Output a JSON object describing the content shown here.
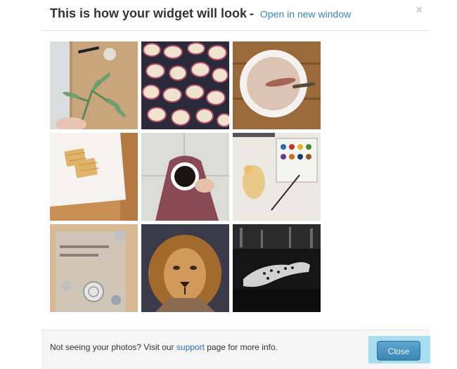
{
  "header": {
    "title": "This is how your widget will look",
    "separator": "-",
    "open_link": "Open in new window",
    "close_symbol": "×"
  },
  "photos": [
    {
      "subject": "plant sprig on wooden table",
      "icon": "plant-photo"
    },
    {
      "subject": "sliced red potatoes on tray",
      "icon": "potatoes-photo"
    },
    {
      "subject": "mug of hot chocolate",
      "icon": "cocoa-photo"
    },
    {
      "subject": "waffles on white plate",
      "icon": "waffles-photo"
    },
    {
      "subject": "coffee cup held on lap",
      "icon": "coffee-photo"
    },
    {
      "subject": "watercolor paints and sketch",
      "icon": "watercolor-photo"
    },
    {
      "subject": "crochet book and doilies",
      "icon": "crochet-photo"
    },
    {
      "subject": "lion head sculpture",
      "icon": "lion-photo"
    },
    {
      "subject": "leopard in black and white",
      "icon": "leopard-photo"
    }
  ],
  "footer": {
    "text_before": "Not seeing your photos? Visit our ",
    "support_link": "support",
    "text_after": " page for more info.",
    "close_button": "Close"
  },
  "colors": {
    "link": "#3a87ad",
    "button": "#3b86b4",
    "highlight": "#a8ddf0"
  }
}
